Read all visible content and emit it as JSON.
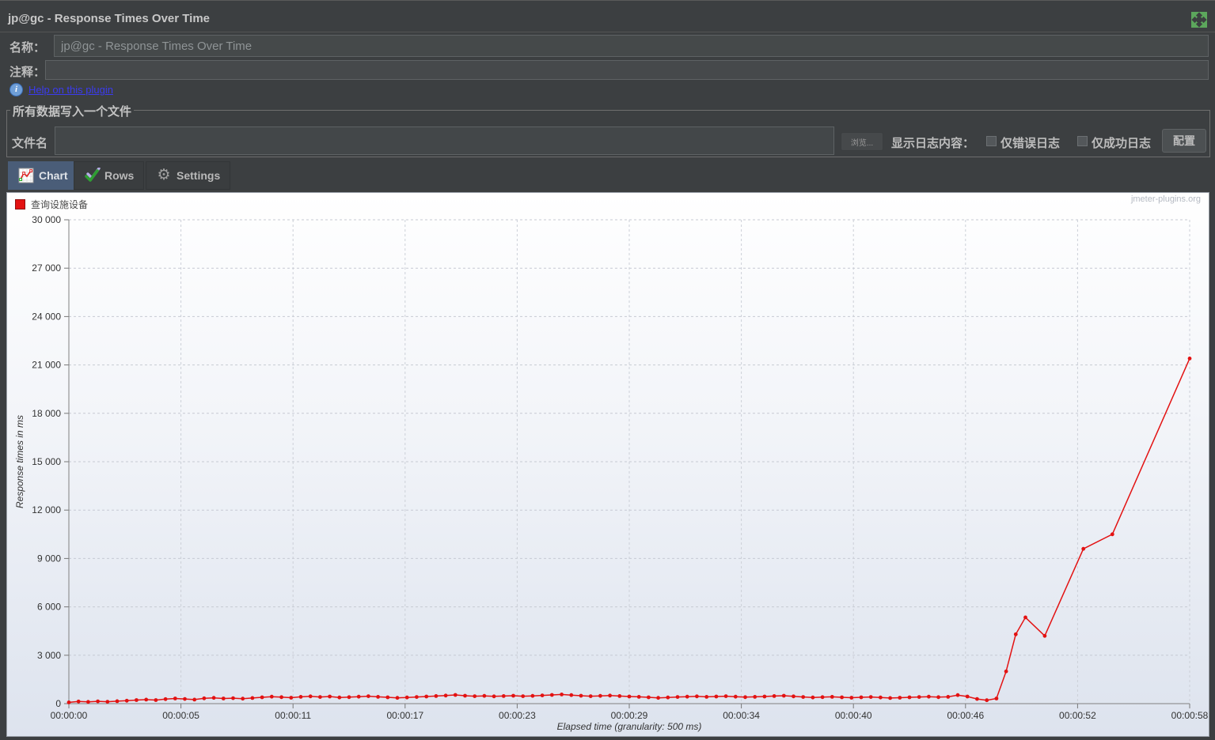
{
  "window": {
    "title": "jp@gc - Response Times Over Time"
  },
  "form": {
    "name_label": "名称：",
    "name_value": "jp@gc - Response Times Over Time",
    "comment_label": "注释：",
    "comment_value": "",
    "help_link": "Help on this plugin",
    "info_glyph": "i"
  },
  "file_group": {
    "title": "所有数据写入一个文件",
    "filename_label": "文件名",
    "filename_value": "",
    "browse_button": "浏览...",
    "log_display_label": "显示日志内容：",
    "errors_checkbox_label": "仅错误日志",
    "success_checkbox_label": "仅成功日志",
    "configure_button": "配置"
  },
  "tabs": [
    {
      "label": "Chart",
      "icon": "chart-icon",
      "selected": true
    },
    {
      "label": "Rows",
      "icon": "checkmarks-icon",
      "selected": false
    },
    {
      "label": "Settings",
      "icon": "gear-icon",
      "selected": false
    }
  ],
  "chart": {
    "watermark": "jmeter-plugins.org",
    "gear_glyph": "⚙"
  },
  "chart_data": {
    "type": "line",
    "title": "",
    "xlabel": "Elapsed time (granularity: 500 ms)",
    "ylabel": "Response times in ms",
    "xlim": [
      0,
      58
    ],
    "ylim": [
      0,
      30000
    ],
    "grid": true,
    "legend_position": "top-left",
    "ytick_labels": [
      "0",
      "3 000",
      "6 000",
      "9 000",
      "12 000",
      "15 000",
      "18 000",
      "21 000",
      "24 000",
      "27 000",
      "30 000"
    ],
    "xtick_labels": [
      "00:00:00",
      "00:00:05",
      "00:00:11",
      "00:00:17",
      "00:00:23",
      "00:00:29",
      "00:00:34",
      "00:00:40",
      "00:00:46",
      "00:00:52",
      "00:00:58"
    ],
    "series": [
      {
        "name": "查询设施设备",
        "color": "#e31212",
        "points": [
          [
            0,
            80
          ],
          [
            0.5,
            130
          ],
          [
            1,
            110
          ],
          [
            1.5,
            140
          ],
          [
            2,
            120
          ],
          [
            2.5,
            150
          ],
          [
            3,
            180
          ],
          [
            3.5,
            220
          ],
          [
            4,
            250
          ],
          [
            4.5,
            220
          ],
          [
            5,
            280
          ],
          [
            5.5,
            320
          ],
          [
            6,
            290
          ],
          [
            6.5,
            250
          ],
          [
            7,
            330
          ],
          [
            7.5,
            360
          ],
          [
            8,
            320
          ],
          [
            8.5,
            340
          ],
          [
            9,
            310
          ],
          [
            9.5,
            350
          ],
          [
            10,
            390
          ],
          [
            10.5,
            430
          ],
          [
            11,
            400
          ],
          [
            11.5,
            370
          ],
          [
            12,
            420
          ],
          [
            12.5,
            450
          ],
          [
            13,
            410
          ],
          [
            13.5,
            440
          ],
          [
            14,
            380
          ],
          [
            14.5,
            400
          ],
          [
            15,
            430
          ],
          [
            15.5,
            460
          ],
          [
            16,
            420
          ],
          [
            16.5,
            390
          ],
          [
            17,
            360
          ],
          [
            17.5,
            380
          ],
          [
            18,
            410
          ],
          [
            18.5,
            440
          ],
          [
            19,
            470
          ],
          [
            19.5,
            500
          ],
          [
            20,
            540
          ],
          [
            20.5,
            490
          ],
          [
            21,
            460
          ],
          [
            21.5,
            480
          ],
          [
            22,
            450
          ],
          [
            22.5,
            470
          ],
          [
            23,
            490
          ],
          [
            23.5,
            460
          ],
          [
            24,
            480
          ],
          [
            24.5,
            510
          ],
          [
            25,
            540
          ],
          [
            25.5,
            570
          ],
          [
            26,
            530
          ],
          [
            26.5,
            490
          ],
          [
            27,
            460
          ],
          [
            27.5,
            480
          ],
          [
            28,
            500
          ],
          [
            28.5,
            470
          ],
          [
            29,
            440
          ],
          [
            29.5,
            420
          ],
          [
            30,
            390
          ],
          [
            30.5,
            360
          ],
          [
            31,
            380
          ],
          [
            31.5,
            410
          ],
          [
            32,
            430
          ],
          [
            32.5,
            450
          ],
          [
            33,
            420
          ],
          [
            33.5,
            440
          ],
          [
            34,
            460
          ],
          [
            34.5,
            430
          ],
          [
            35,
            400
          ],
          [
            35.5,
            420
          ],
          [
            36,
            440
          ],
          [
            36.5,
            470
          ],
          [
            37,
            490
          ],
          [
            37.5,
            450
          ],
          [
            38,
            410
          ],
          [
            38.5,
            380
          ],
          [
            39,
            400
          ],
          [
            39.5,
            420
          ],
          [
            40,
            390
          ],
          [
            40.5,
            370
          ],
          [
            41,
            390
          ],
          [
            41.5,
            410
          ],
          [
            42,
            380
          ],
          [
            42.5,
            350
          ],
          [
            43,
            370
          ],
          [
            43.5,
            390
          ],
          [
            44,
            410
          ],
          [
            44.5,
            430
          ],
          [
            45,
            400
          ],
          [
            45.5,
            420
          ],
          [
            46,
            530
          ],
          [
            46.5,
            440
          ],
          [
            47,
            290
          ],
          [
            47.5,
            210
          ],
          [
            48,
            320
          ],
          [
            48.5,
            2000
          ],
          [
            49,
            4300
          ],
          [
            49.5,
            5350
          ],
          [
            50.5,
            4200
          ],
          [
            52.5,
            9600
          ],
          [
            54,
            10500
          ],
          [
            58,
            21400
          ]
        ]
      }
    ]
  }
}
